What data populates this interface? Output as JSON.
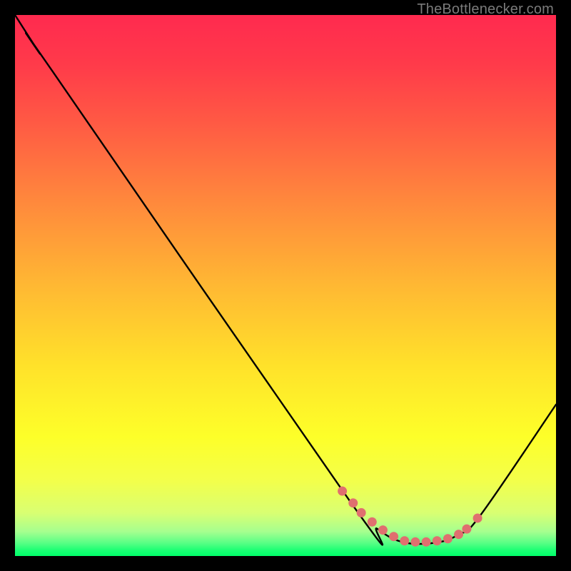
{
  "attribution": "TheBottlenecker.com",
  "chart_data": {
    "type": "line",
    "title": "",
    "xlabel": "",
    "ylabel": "",
    "xlim": [
      0,
      100
    ],
    "ylim": [
      0,
      100
    ],
    "gradient_stops": [
      {
        "offset": 0.0,
        "color": "#ff2a4f"
      },
      {
        "offset": 0.09,
        "color": "#ff3a4a"
      },
      {
        "offset": 0.2,
        "color": "#ff5a44"
      },
      {
        "offset": 0.35,
        "color": "#ff8a3c"
      },
      {
        "offset": 0.5,
        "color": "#ffb833"
      },
      {
        "offset": 0.65,
        "color": "#ffe22a"
      },
      {
        "offset": 0.78,
        "color": "#fdff29"
      },
      {
        "offset": 0.86,
        "color": "#f3ff4a"
      },
      {
        "offset": 0.92,
        "color": "#d9ff72"
      },
      {
        "offset": 0.955,
        "color": "#a6ff8f"
      },
      {
        "offset": 0.975,
        "color": "#5cff86"
      },
      {
        "offset": 0.99,
        "color": "#19ff73"
      },
      {
        "offset": 1.0,
        "color": "#00ff6a"
      }
    ],
    "series": [
      {
        "name": "bottleneck-curve",
        "x": [
          0.0,
          4.5,
          7.0,
          62.0,
          67.0,
          72.0,
          78.0,
          82.0,
          86.0,
          100.0
        ],
        "y": [
          100.0,
          93.0,
          89.5,
          10.0,
          5.0,
          2.5,
          2.5,
          4.0,
          7.5,
          28.0
        ]
      }
    ],
    "highlight_points": {
      "name": "optimal-range",
      "color": "#e06f6f",
      "x": [
        60.5,
        62.5,
        64.0,
        66.0,
        68.0,
        70.0,
        72.0,
        74.0,
        76.0,
        78.0,
        80.0,
        82.0,
        83.5,
        85.5
      ],
      "y": [
        12.0,
        9.8,
        8.0,
        6.3,
        4.8,
        3.6,
        2.8,
        2.6,
        2.6,
        2.8,
        3.2,
        4.0,
        5.0,
        7.0
      ]
    }
  }
}
